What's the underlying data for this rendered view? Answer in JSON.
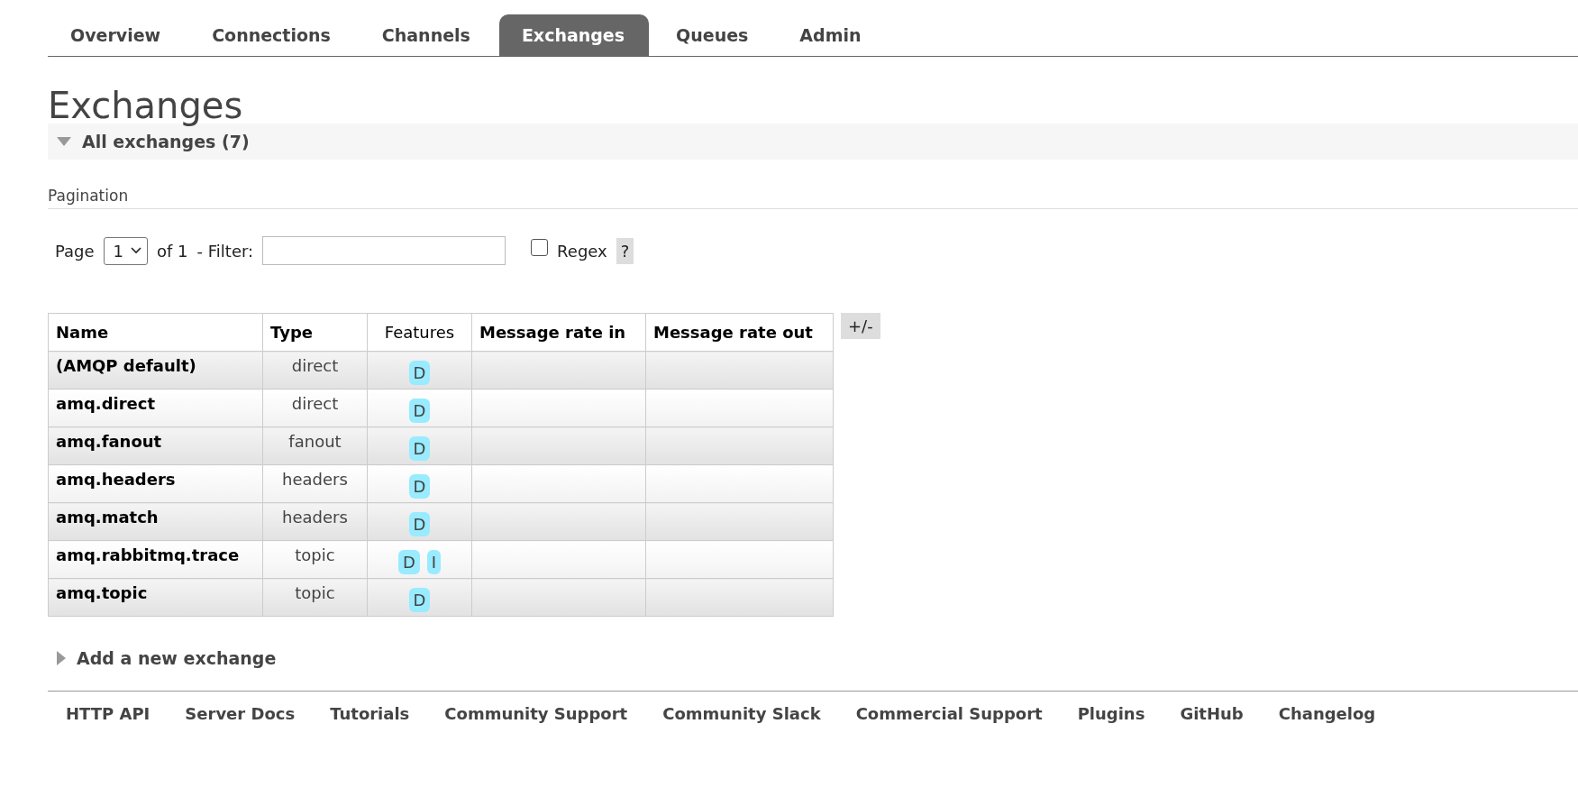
{
  "tabs": [
    {
      "label": "Overview",
      "selected": false
    },
    {
      "label": "Connections",
      "selected": false
    },
    {
      "label": "Channels",
      "selected": false
    },
    {
      "label": "Exchanges",
      "selected": true
    },
    {
      "label": "Queues",
      "selected": false
    },
    {
      "label": "Admin",
      "selected": false
    }
  ],
  "page_title": "Exchanges",
  "section": {
    "title": "All exchanges (7)",
    "expanded": true
  },
  "pagination": {
    "heading": "Pagination",
    "page_label": "Page",
    "page_value": "1",
    "of_label": "of 1",
    "filter_label": "- Filter:",
    "regex_label": "Regex",
    "regex_checked": false,
    "help": "?"
  },
  "table": {
    "columns": [
      "Name",
      "Type",
      "Features",
      "Message rate in",
      "Message rate out"
    ],
    "toggle": "+/-",
    "rows": [
      {
        "name": "(AMQP default)",
        "type": "direct",
        "features": [
          "D"
        ]
      },
      {
        "name": "amq.direct",
        "type": "direct",
        "features": [
          "D"
        ]
      },
      {
        "name": "amq.fanout",
        "type": "fanout",
        "features": [
          "D"
        ]
      },
      {
        "name": "amq.headers",
        "type": "headers",
        "features": [
          "D"
        ]
      },
      {
        "name": "amq.match",
        "type": "headers",
        "features": [
          "D"
        ]
      },
      {
        "name": "amq.rabbitmq.trace",
        "type": "topic",
        "features": [
          "D",
          "I"
        ]
      },
      {
        "name": "amq.topic",
        "type": "topic",
        "features": [
          "D"
        ]
      }
    ]
  },
  "add_section": {
    "title": "Add a new exchange",
    "expanded": false
  },
  "footer_links": [
    "HTTP API",
    "Server Docs",
    "Tutorials",
    "Community Support",
    "Community Slack",
    "Commercial Support",
    "Plugins",
    "GitHub",
    "Changelog"
  ]
}
